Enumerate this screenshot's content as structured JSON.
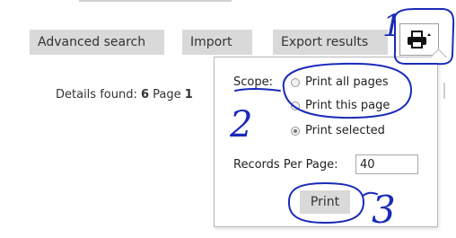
{
  "toolbar": {
    "advanced_search": "Advanced search",
    "import": "Import",
    "export_results": "Export results",
    "print_icon": "printer-icon"
  },
  "details": {
    "label": "Details found:",
    "count": "6",
    "page_label": "Page",
    "page": "1"
  },
  "print_popup": {
    "scope_label": "Scope:",
    "options": [
      {
        "label": "Print all pages",
        "selected": false
      },
      {
        "label": "Print this page",
        "selected": false
      },
      {
        "label": "Print selected",
        "selected": true
      }
    ],
    "records_per_page_label": "Records Per Page:",
    "records_per_page_value": "40",
    "print_button": "Print"
  },
  "annotations": {
    "step1": "1",
    "step2": "2",
    "step3": "3",
    "ink_color": "#1a2bb8"
  }
}
